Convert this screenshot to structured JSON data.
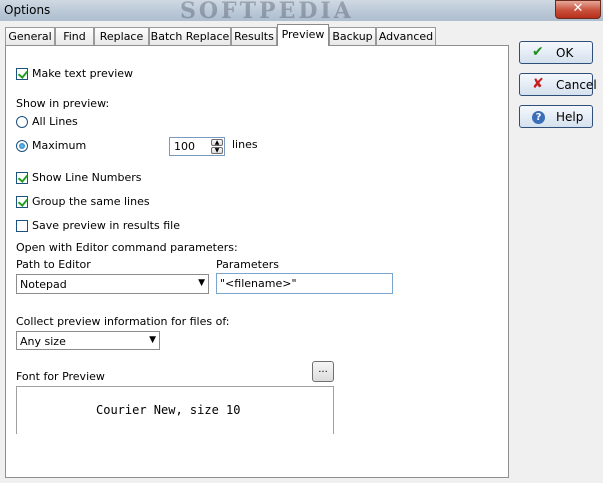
{
  "window": {
    "title": "Options",
    "watermark": "SOFTPEDIA",
    "close_label": "✕"
  },
  "tabs": [
    {
      "label": "General"
    },
    {
      "label": "Find"
    },
    {
      "label": "Replace"
    },
    {
      "label": "Batch Replace"
    },
    {
      "label": "Results"
    },
    {
      "label": "Preview"
    },
    {
      "label": "Backup"
    },
    {
      "label": "Advanced"
    }
  ],
  "active_tab": "Preview",
  "preview": {
    "make_text_preview": {
      "label": "Make text preview",
      "checked": true
    },
    "show_in_preview_label": "Show in preview:",
    "all_lines": {
      "label": "All Lines",
      "selected": false
    },
    "maximum": {
      "label": "Maximum",
      "selected": true
    },
    "max_lines_value": "100",
    "lines_label": "lines",
    "show_line_numbers": {
      "label": "Show Line Numbers",
      "checked": true
    },
    "group_same_lines": {
      "label": "Group the same lines",
      "checked": true
    },
    "save_preview": {
      "label": "Save preview in results file",
      "checked": false
    },
    "open_with_editor_label": "Open with Editor command parameters:",
    "path_to_editor_label": "Path to Editor",
    "path_to_editor_value": "Notepad",
    "parameters_label": "Parameters",
    "parameters_value": "\"<filename>\"",
    "collect_info_label": "Collect preview information for files of:",
    "collect_info_value": "Any size",
    "font_for_preview_label": "Font for Preview",
    "font_browse_label": "...",
    "font_sample": "Courier New, size 10"
  },
  "buttons": {
    "ok": {
      "label": "OK",
      "icon": "checkmark-icon"
    },
    "cancel": {
      "label": "Cancel",
      "icon": "x-icon"
    },
    "help": {
      "label": "Help",
      "icon": "help-icon"
    }
  },
  "colors": {
    "ok_icon": "#1e8f1e",
    "cancel_icon": "#c62020",
    "help_icon": "#3a6fb7"
  }
}
